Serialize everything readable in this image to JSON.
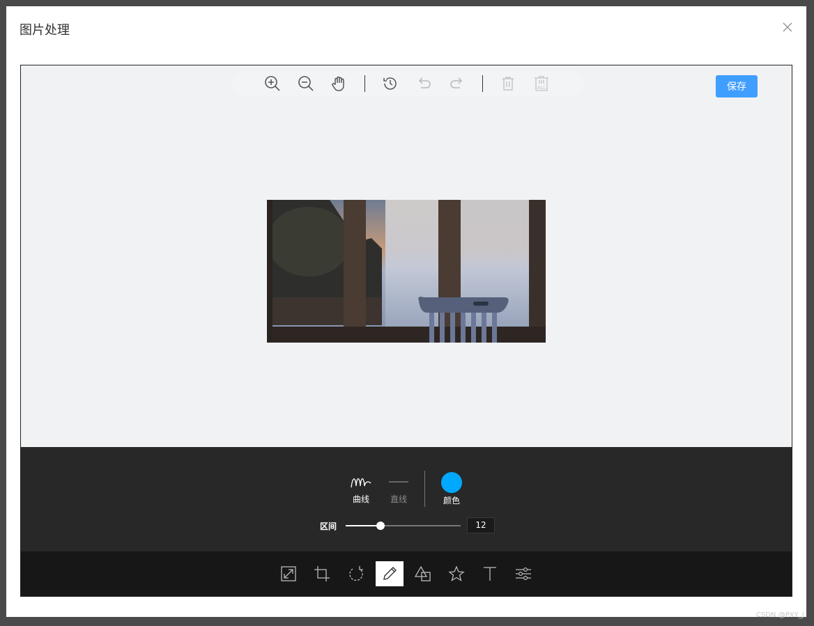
{
  "dialog": {
    "title": "图片处理"
  },
  "toolbar": {
    "save_label": "保存"
  },
  "draw_panel": {
    "curve_label": "曲线",
    "line_label": "直线",
    "color_label": "颜色",
    "color_value": "#00a9ff",
    "range_label": "区间",
    "range_value": "12",
    "range_fraction": 0.3,
    "selected_mode": "曲线"
  },
  "bottom_tools": {
    "active_tool": "draw",
    "items": [
      "resize",
      "crop",
      "rotate",
      "draw",
      "shape",
      "icon",
      "text",
      "filter"
    ]
  },
  "watermark": "CSDN @PXY_J"
}
